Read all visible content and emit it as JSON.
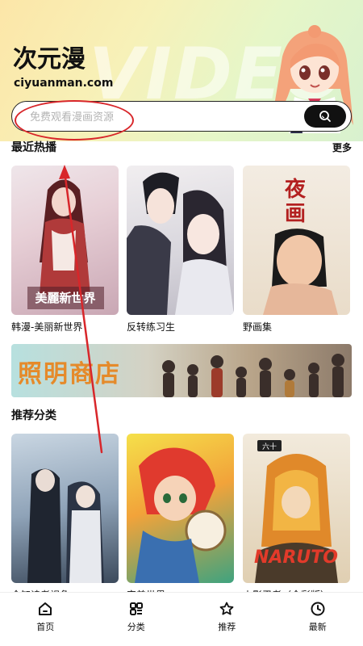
{
  "header": {
    "app_title": "次元漫",
    "app_domain": "ciyuanman.com",
    "watermark": "VIDEO"
  },
  "search": {
    "placeholder": "免费观看漫画资源",
    "value": ""
  },
  "recent": {
    "title": "最近热播",
    "more": "更多",
    "items": [
      {
        "title": "韩漫-美丽新世界"
      },
      {
        "title": "反转练习生"
      },
      {
        "title": "野画集"
      }
    ]
  },
  "banner": {
    "text": "照明商店"
  },
  "recommend": {
    "title": "推荐分类",
    "items": [
      {
        "title": "全知读者视角"
      },
      {
        "title": "完美世界"
      },
      {
        "title": "火影忍者（全彩版）"
      }
    ]
  },
  "nav": {
    "items": [
      {
        "label": "首页",
        "icon": "home-icon"
      },
      {
        "label": "分类",
        "icon": "category-icon"
      },
      {
        "label": "推荐",
        "icon": "star-icon"
      },
      {
        "label": "最新",
        "icon": "clock-icon"
      }
    ]
  },
  "colors": {
    "annotation_red": "#d8262a",
    "banner_text": "#e58a2a",
    "accent_dark": "#111111"
  }
}
